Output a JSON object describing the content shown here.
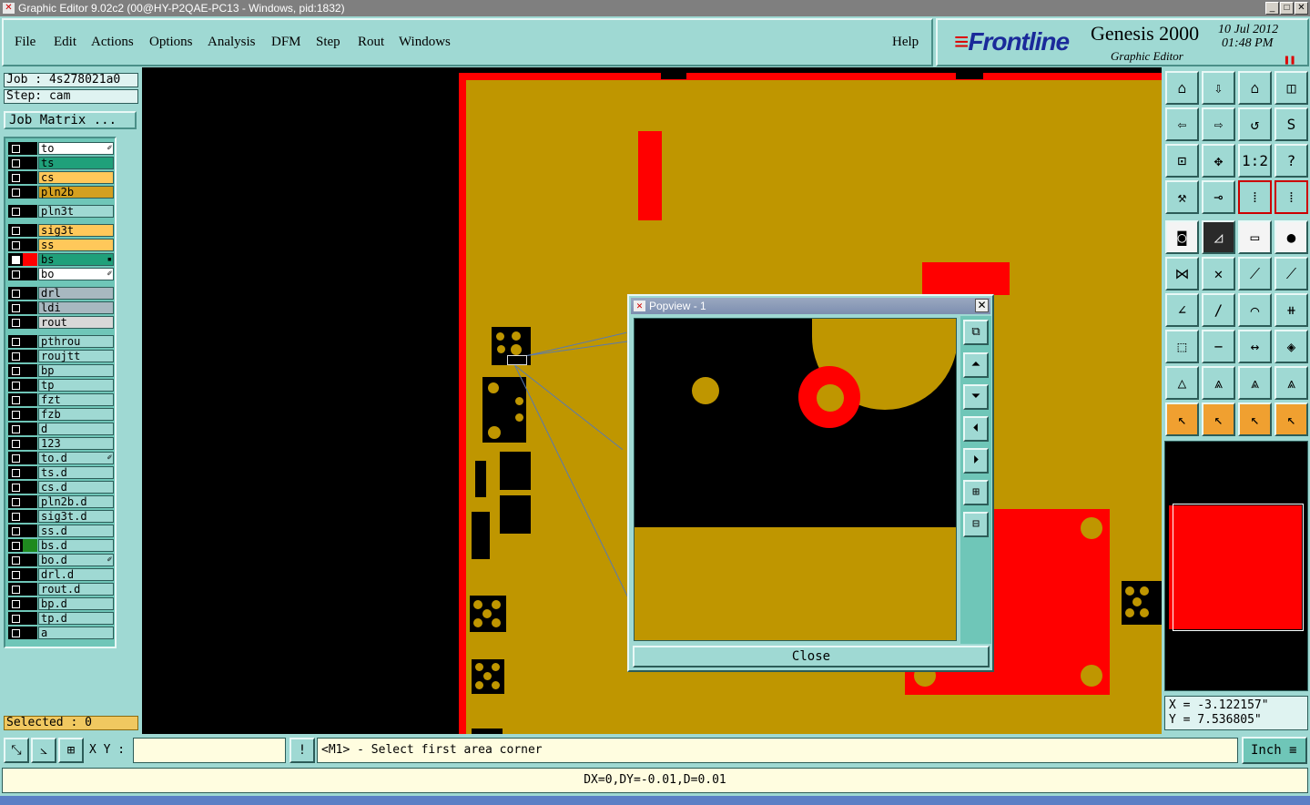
{
  "window": {
    "title": "Graphic Editor 9.02c2 (00@HY-P2QAE-PC13 - Windows, pid:1832)"
  },
  "menu": [
    "File",
    "Edit",
    "Actions",
    "Options",
    "Analysis",
    "DFM",
    "Step",
    "Rout",
    "Windows"
  ],
  "help_label": "Help",
  "brand": {
    "logo": "Frontline",
    "product": "Genesis 2000",
    "subtitle": "Graphic Editor",
    "date": "10 Jul 2012",
    "time": "01:48 PM"
  },
  "job": {
    "job_label": "Job : 4s278021a0",
    "step_label": "Step: cam",
    "matrix_button": "Job Matrix ..."
  },
  "layers": [
    {
      "name": "to",
      "color": "#ffffff",
      "mark": "✐",
      "gap": 0
    },
    {
      "name": "ts",
      "color": "#1fa07a",
      "mark": "",
      "gap": 0
    },
    {
      "name": "cs",
      "color": "#ffc85a",
      "mark": "",
      "gap": 0
    },
    {
      "name": "pln2b",
      "color": "#d4a020",
      "mark": "",
      "gap": 0
    },
    {
      "name": "pln3t",
      "color": "#9fd9d3",
      "mark": "",
      "gap": 1
    },
    {
      "name": "sig3t",
      "color": "#ffc85a",
      "mark": "",
      "gap": 1
    },
    {
      "name": "ss",
      "color": "#ffc85a",
      "mark": "",
      "gap": 0
    },
    {
      "name": "bs",
      "color": "#1fa07a",
      "mark": "▪",
      "gap": 0
    },
    {
      "name": "bo",
      "color": "#ffffff",
      "mark": "✐",
      "gap": 0
    },
    {
      "name": "drl",
      "color": "#a8b8c0",
      "mark": "",
      "gap": 1
    },
    {
      "name": "ldi",
      "color": "#a8b8c0",
      "mark": "",
      "gap": 0
    },
    {
      "name": "rout",
      "color": "#d8d8d8",
      "mark": "",
      "gap": 0
    },
    {
      "name": "pthrou",
      "color": "#9fd9d3",
      "mark": "",
      "gap": 1
    },
    {
      "name": "roujtt",
      "color": "#9fd9d3",
      "mark": "",
      "gap": 0
    },
    {
      "name": "bp",
      "color": "#9fd9d3",
      "mark": "",
      "gap": 0
    },
    {
      "name": "tp",
      "color": "#9fd9d3",
      "mark": "",
      "gap": 0
    },
    {
      "name": "fzt",
      "color": "#9fd9d3",
      "mark": "",
      "gap": 0
    },
    {
      "name": "fzb",
      "color": "#9fd9d3",
      "mark": "",
      "gap": 0
    },
    {
      "name": "d",
      "color": "#9fd9d3",
      "mark": "",
      "gap": 0
    },
    {
      "name": "123",
      "color": "#9fd9d3",
      "mark": "",
      "gap": 0
    },
    {
      "name": "to.d",
      "color": "#9fd9d3",
      "mark": "✐",
      "gap": 0
    },
    {
      "name": "ts.d",
      "color": "#9fd9d3",
      "mark": "",
      "gap": 0
    },
    {
      "name": "cs.d",
      "color": "#9fd9d3",
      "mark": "",
      "gap": 0
    },
    {
      "name": "pln2b.d",
      "color": "#9fd9d3",
      "mark": "",
      "gap": 0
    },
    {
      "name": "sig3t.d",
      "color": "#9fd9d3",
      "mark": "",
      "gap": 0
    },
    {
      "name": "ss.d",
      "color": "#9fd9d3",
      "mark": "",
      "gap": 0
    },
    {
      "name": "bs.d",
      "color": "#9fd9d3",
      "mark": "",
      "gap": 0
    },
    {
      "name": "bo.d",
      "color": "#9fd9d3",
      "mark": "✐",
      "gap": 0
    },
    {
      "name": "drl.d",
      "color": "#9fd9d3",
      "mark": "",
      "gap": 0
    },
    {
      "name": "rout.d",
      "color": "#9fd9d3",
      "mark": "",
      "gap": 0
    },
    {
      "name": "bp.d",
      "color": "#9fd9d3",
      "mark": "",
      "gap": 0
    },
    {
      "name": "tp.d",
      "color": "#9fd9d3",
      "mark": "",
      "gap": 0
    },
    {
      "name": "a",
      "color": "#9fd9d3",
      "mark": "",
      "gap": 0
    }
  ],
  "selected_label": "Selected : 0",
  "popview": {
    "title": "Popview - 1",
    "close_label": "Close"
  },
  "coords": {
    "x": "X = -3.122157\"",
    "y": "Y = 7.536805\""
  },
  "bottom": {
    "xy_label": "X Y :",
    "xy_value": "",
    "prompt": "<M1> - Select first area corner",
    "units": "Inch"
  },
  "status": "DX=0,DY=-0.01,D=0.01",
  "colors": {
    "panel": "#9fd9d3",
    "copper": "#bf9600",
    "feature": "#ff0000"
  }
}
